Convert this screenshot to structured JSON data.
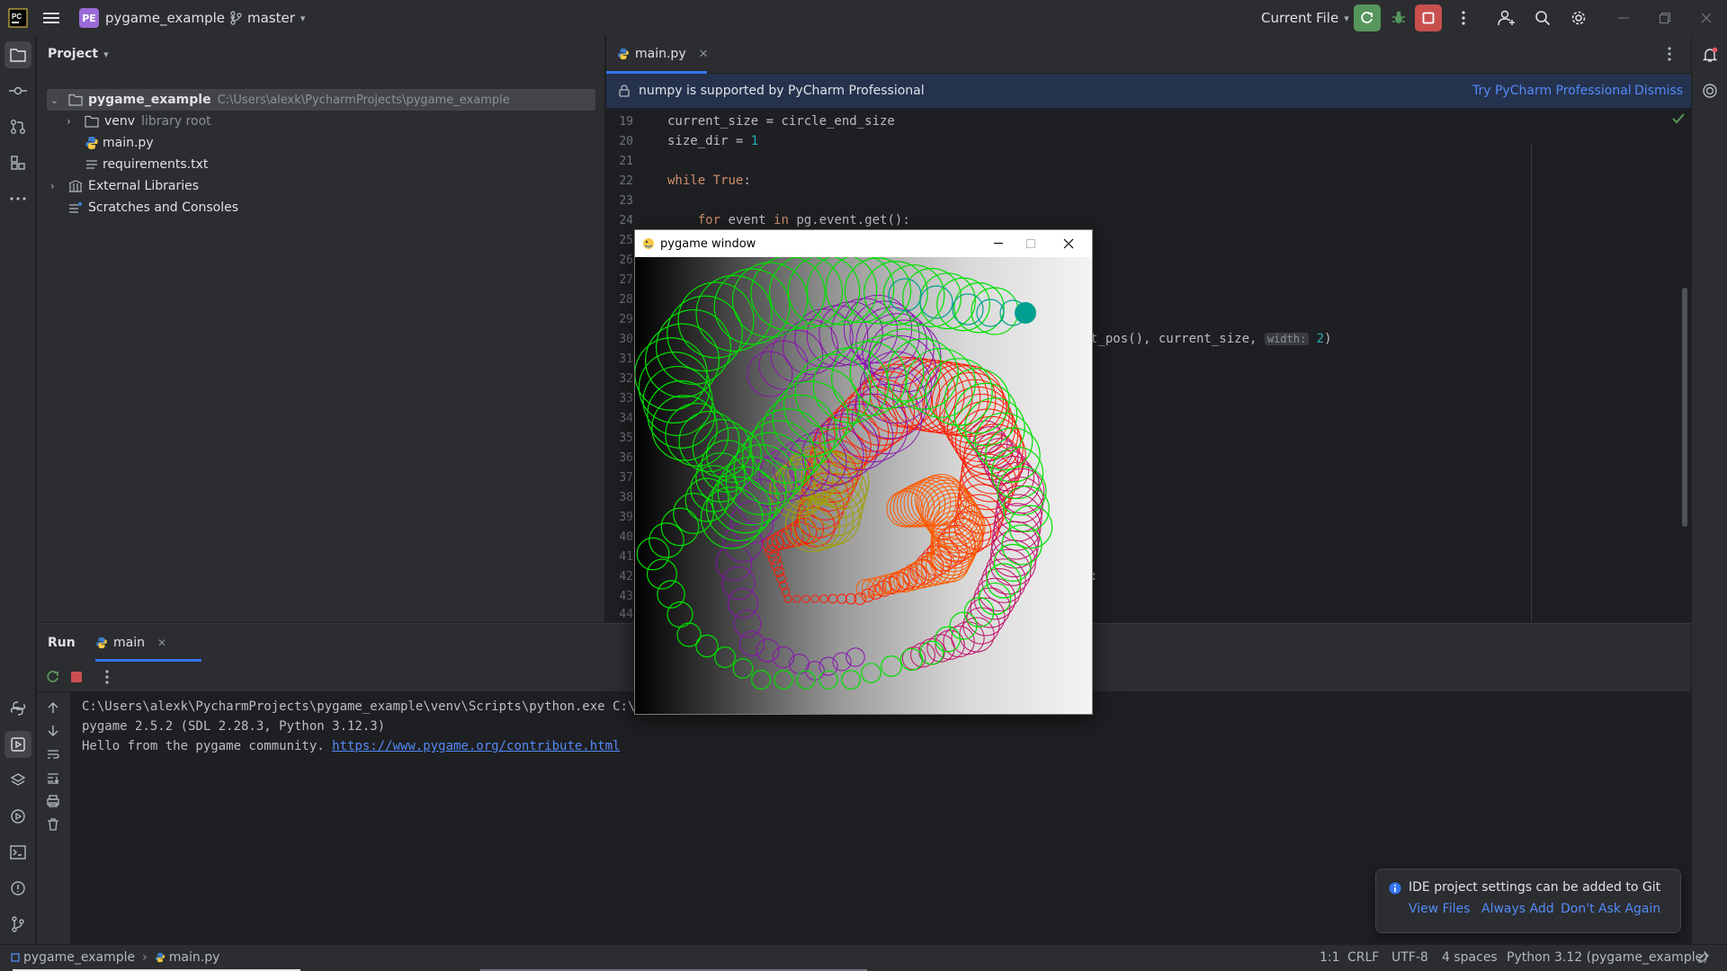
{
  "titlebar": {
    "app_icon": "pycharm-logo",
    "project_badge": "PE",
    "project_name": "pygame_example",
    "branch": "master",
    "run_config": "Current File"
  },
  "project_panel": {
    "title": "Project",
    "tree": [
      {
        "label": "pygame_example",
        "hint": "C:\\Users\\alexk\\PycharmProjects\\pygame_example"
      },
      {
        "label": "venv",
        "hint": "library root"
      },
      {
        "label": "main.py",
        "hint": ""
      },
      {
        "label": "requirements.txt",
        "hint": ""
      },
      {
        "label": "External Libraries",
        "hint": ""
      },
      {
        "label": "Scratches and Consoles",
        "hint": ""
      }
    ]
  },
  "editor": {
    "tab": "main.py",
    "banner": {
      "text": "numpy is supported by PyCharm Professional",
      "action": "Try PyCharm Professional",
      "dismiss": "Dismiss"
    },
    "line_numbers": [
      "19",
      "20",
      "21",
      "22",
      "23",
      "24",
      "25",
      "26",
      "27",
      "28",
      "29",
      "30",
      "31",
      "32",
      "33",
      "34",
      "35",
      "36",
      "37",
      "38",
      "39",
      "40",
      "41",
      "42",
      "43",
      "44"
    ],
    "code": {
      "l19": "current_size = circle_end_size",
      "l20a": "size_dir = ",
      "l20b": "1",
      "l22a": "while",
      "l22b": "True",
      "l22c": ":",
      "l24a": "    ",
      "l24b": "for",
      "l24c": " event ",
      "l24d": "in",
      "l24e": " pg.event.get():",
      "l28a": "t_pos(), current_size, ",
      "l28hint": "width:",
      "l28b": "2",
      "l28c": ")",
      "l40": ":"
    }
  },
  "pygame_window": {
    "title": "pygame window"
  },
  "run_panel": {
    "title": "Run",
    "tab": "main",
    "lines": [
      "C:\\Users\\alexk\\PycharmProjects\\pygame_example\\venv\\Scripts\\python.exe C:\\Users\\alexk\\PycharmProjects\\pygame_example\\main.py",
      "pygame 2.5.2 (SDL 2.28.3, Python 3.12.3)"
    ],
    "hello_prefix": "Hello from the pygame community. ",
    "hello_link": "https://www.pygame.org/contribute.html"
  },
  "notification": {
    "text": "IDE project settings can be added to Git",
    "actions": [
      "View Files",
      "Always Add",
      "Don't Ask Again"
    ]
  },
  "statusbar": {
    "crumb_project": "pygame_example",
    "crumb_file": "main.py",
    "position": "1:1",
    "line_sep": "CRLF",
    "encoding": "UTF-8",
    "indent": "4 spaces",
    "interpreter": "Python 3.12 (pygame_example)"
  },
  "colors": {
    "accent_green": "#57965c",
    "accent_red": "#c94f4f",
    "link": "#548af7",
    "project_badge": "#9a6bd8"
  }
}
